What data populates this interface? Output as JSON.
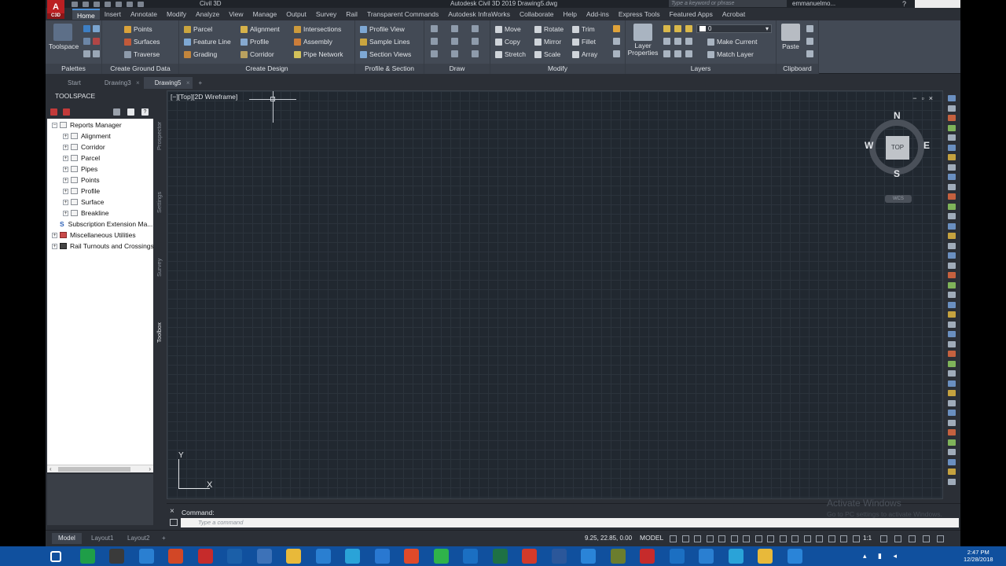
{
  "titlebar": {
    "app_logo": "A",
    "app_logo_sub": "C3D",
    "workspace": "Civil 3D",
    "document_title": "Autodesk Civil 3D 2019   Drawing5.dwg",
    "search_placeholder": "Type a keyword or phrase",
    "user": "emmanuelmo..."
  },
  "ribbon_tabs": [
    "Home",
    "Insert",
    "Annotate",
    "Modify",
    "Analyze",
    "View",
    "Manage",
    "Output",
    "Survey",
    "Rail",
    "Transparent Commands",
    "Autodesk InfraWorks",
    "Collaborate",
    "Help",
    "Add-ins",
    "Express Tools",
    "Featured Apps",
    "Acrobat"
  ],
  "ribbon_active_tab": "Home",
  "ribbon": {
    "palettes": {
      "title": "Palettes",
      "toolspace": "Toolspace"
    },
    "ground": {
      "title": "Create Ground Data",
      "points": "Points",
      "surfaces": "Surfaces",
      "traverse": "Traverse"
    },
    "design": {
      "title": "Create Design",
      "parcel": "Parcel",
      "feature_line": "Feature Line",
      "grading": "Grading",
      "alignment": "Alignment",
      "profile": "Profile",
      "corridor": "Corridor",
      "intersections": "Intersections",
      "assembly": "Assembly",
      "pipe_network": "Pipe Network"
    },
    "section": {
      "title": "Profile & Section Views",
      "profile_view": "Profile View",
      "sample_lines": "Sample Lines",
      "section_views": "Section Views"
    },
    "draw": {
      "title": "Draw"
    },
    "modify": {
      "title": "Modify",
      "move": "Move",
      "rotate": "Rotate",
      "trim": "Trim",
      "copy": "Copy",
      "mirror": "Mirror",
      "fillet": "Fillet",
      "stretch": "Stretch",
      "scale": "Scale",
      "array": "Array"
    },
    "layers": {
      "title": "Layers",
      "layer_properties": "Layer Properties",
      "layer_value": "0",
      "make_current": "Make Current",
      "match_layer": "Match Layer"
    },
    "clipboard": {
      "title": "Clipboard",
      "paste": "Paste"
    }
  },
  "doc_tabs": [
    {
      "label": "Start"
    },
    {
      "label": "Drawing3"
    },
    {
      "label": "Drawing5"
    }
  ],
  "toolspace": {
    "title": "TOOLSPACE",
    "tree": {
      "root": "Reports Manager",
      "children": [
        "Alignment",
        "Corridor",
        "Parcel",
        "Pipes",
        "Points",
        "Profile",
        "Surface",
        "Breakline"
      ],
      "others": [
        "Subscription Extension Ma...",
        "Miscellaneous Utilities",
        "Rail Turnouts and Crossings"
      ]
    },
    "side_tabs": [
      "Prospector",
      "Settings",
      "Survey",
      "Toolbox"
    ]
  },
  "viewport": {
    "label": "[−][Top][2D Wireframe]",
    "compass": {
      "n": "N",
      "s": "S",
      "e": "E",
      "w": "W",
      "top": "TOP",
      "wcs": "WCS"
    },
    "ucs_x": "X",
    "ucs_y": "Y"
  },
  "command": {
    "label": "Command:",
    "placeholder": "Type a command",
    "watermark_title": "Activate Windows",
    "watermark_sub": "Go to PC settings to activate Windows."
  },
  "status": {
    "layout_tabs": [
      "Model",
      "Layout1",
      "Layout2"
    ],
    "coordinates": "9.25, 22.85, 0.00",
    "model": "MODEL",
    "scale": "1:1"
  },
  "taskbar": {
    "time": "2:47 PM",
    "date": "12/28/2018"
  }
}
